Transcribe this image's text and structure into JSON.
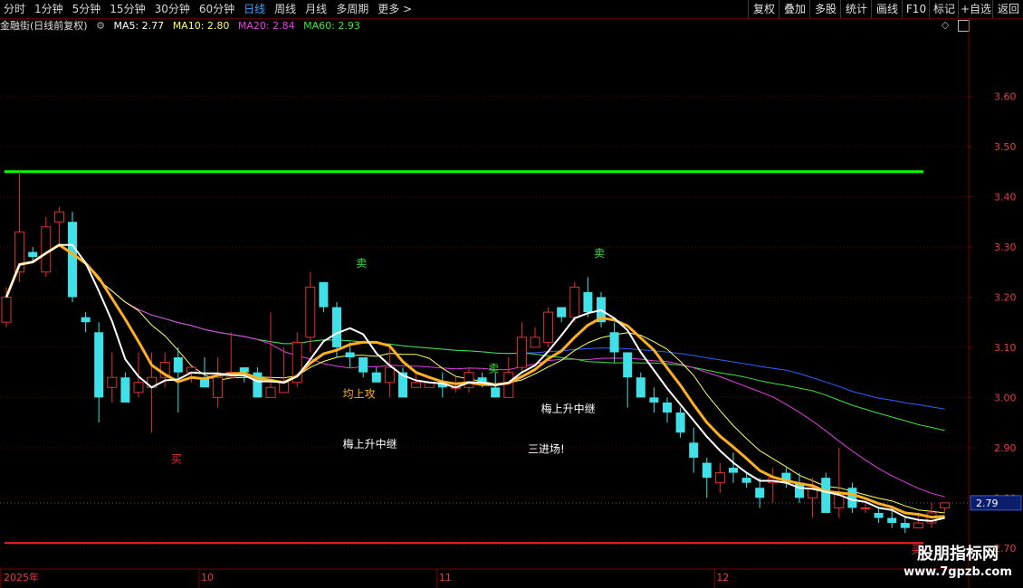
{
  "toolbar": {
    "left_items": [
      "分时",
      "1分钟",
      "5分钟",
      "15分钟",
      "30分钟",
      "60分钟",
      "日线",
      "周线",
      "月线",
      "多周期",
      "更多 >"
    ],
    "active": "日线",
    "right_items": [
      "复权",
      "叠加",
      "多股",
      "统计",
      "画线",
      "F10",
      "标记",
      "+自选",
      "返回"
    ]
  },
  "info": {
    "title": "金融街(日线前复权)",
    "ma5_label": "MA5: 2.77",
    "ma10_label": "MA10: 2.80",
    "ma20_label": "MA20: 2.84",
    "ma60_label": "MA60: 2.93"
  },
  "colors": {
    "up": "#e03030",
    "down": "#40e0e8",
    "ma5": "#ffffff",
    "ma10": "#ffff60",
    "ma20": "#e040e0",
    "ma60": "#40e040",
    "ma_long": "#3060ff",
    "thick": "#ffb020",
    "resistance": "#00ff00",
    "support": "#ff2020"
  },
  "watermark": {
    "line1": "股朋指标网",
    "line2": "www.7gpzb.com"
  },
  "chart_data": {
    "type": "candlestick",
    "ylim": [
      2.66,
      3.72
    ],
    "yticks": [
      "3.60",
      "3.50",
      "3.40",
      "3.30",
      "3.20",
      "3.10",
      "3.00",
      "2.90",
      "2.80",
      "2.70"
    ],
    "current_price": "2.79",
    "x_labels": [
      "2025年",
      "10",
      "11",
      "12"
    ],
    "resistance": 3.45,
    "support": 2.71,
    "candles": [
      [
        3.15,
        3.2,
        3.22,
        3.14
      ],
      [
        3.25,
        3.33,
        3.45,
        3.23
      ],
      [
        3.29,
        3.28,
        3.3,
        3.27
      ],
      [
        3.25,
        3.34,
        3.36,
        3.24
      ],
      [
        3.35,
        3.37,
        3.38,
        3.3
      ],
      [
        3.35,
        3.2,
        3.37,
        3.19
      ],
      [
        3.16,
        3.15,
        3.17,
        3.13
      ],
      [
        3.13,
        3.0,
        3.15,
        2.95
      ],
      [
        3.02,
        3.04,
        3.09,
        2.99
      ],
      [
        3.04,
        2.99,
        3.05,
        2.99
      ],
      [
        3.01,
        3.03,
        3.09,
        3.0
      ],
      [
        3.02,
        3.04,
        3.09,
        2.93
      ],
      [
        3.04,
        3.07,
        3.09,
        3.02
      ],
      [
        3.08,
        3.05,
        3.1,
        2.97
      ],
      [
        3.05,
        3.06,
        3.06,
        3.03
      ],
      [
        3.04,
        3.02,
        3.08,
        3.02
      ],
      [
        3.0,
        3.04,
        3.08,
        2.98
      ],
      [
        3.04,
        3.05,
        3.13,
        3.04
      ],
      [
        3.06,
        3.05,
        3.06,
        3.03
      ],
      [
        3.05,
        3.0,
        3.06,
        3.0
      ],
      [
        3.0,
        3.02,
        3.17,
        3.0
      ],
      [
        3.01,
        3.03,
        3.1,
        3.02
      ],
      [
        3.03,
        3.11,
        3.13,
        3.02
      ],
      [
        3.12,
        3.22,
        3.25,
        3.09
      ],
      [
        3.23,
        3.18,
        3.23,
        3.17
      ],
      [
        3.18,
        3.1,
        3.19,
        3.08
      ],
      [
        3.09,
        3.08,
        3.11,
        3.06
      ],
      [
        3.08,
        3.05,
        3.07,
        3.04
      ],
      [
        3.05,
        3.03,
        3.06,
        3.03
      ],
      [
        3.03,
        3.06,
        3.1,
        3.0
      ],
      [
        3.05,
        3.0,
        3.06,
        3.0
      ],
      [
        3.02,
        3.03,
        3.05,
        3.02
      ],
      [
        3.02,
        3.03,
        3.03,
        3.02
      ],
      [
        3.03,
        3.02,
        3.05,
        3.0
      ],
      [
        3.02,
        3.02,
        3.04,
        3.01
      ],
      [
        3.02,
        3.05,
        3.06,
        3.01
      ],
      [
        3.04,
        3.03,
        3.05,
        3.02
      ],
      [
        3.02,
        3.0,
        3.05,
        3.0
      ],
      [
        3.0,
        3.05,
        3.08,
        3.0
      ],
      [
        3.06,
        3.12,
        3.15,
        3.05
      ],
      [
        3.1,
        3.12,
        3.14,
        3.1
      ],
      [
        3.11,
        3.17,
        3.18,
        3.1
      ],
      [
        3.18,
        3.16,
        3.17,
        3.15
      ],
      [
        3.16,
        3.22,
        3.23,
        3.15
      ],
      [
        3.21,
        3.17,
        3.24,
        3.16
      ],
      [
        3.2,
        3.15,
        3.21,
        3.14
      ],
      [
        3.13,
        3.09,
        3.15,
        3.07
      ],
      [
        3.09,
        3.04,
        3.07,
        2.98
      ],
      [
        3.04,
        3.0,
        3.05,
        3.0
      ],
      [
        3.0,
        2.99,
        3.02,
        2.97
      ],
      [
        2.99,
        2.97,
        3.0,
        2.95
      ],
      [
        2.97,
        2.93,
        2.98,
        2.92
      ],
      [
        2.91,
        2.88,
        2.94,
        2.85
      ],
      [
        2.87,
        2.84,
        2.88,
        2.8
      ],
      [
        2.83,
        2.85,
        2.87,
        2.81
      ],
      [
        2.86,
        2.85,
        2.89,
        2.83
      ],
      [
        2.84,
        2.83,
        2.85,
        2.82
      ],
      [
        2.82,
        2.8,
        2.84,
        2.78
      ],
      [
        2.83,
        2.84,
        2.86,
        2.79
      ],
      [
        2.85,
        2.83,
        2.86,
        2.82
      ],
      [
        2.83,
        2.8,
        2.85,
        2.79
      ],
      [
        2.8,
        2.82,
        2.84,
        2.76
      ],
      [
        2.84,
        2.77,
        2.85,
        2.77
      ],
      [
        2.78,
        2.81,
        2.9,
        2.76
      ],
      [
        2.82,
        2.78,
        2.83,
        2.77
      ],
      [
        2.78,
        2.78,
        2.79,
        2.77
      ],
      [
        2.77,
        2.76,
        2.78,
        2.75
      ],
      [
        2.76,
        2.75,
        2.78,
        2.74
      ],
      [
        2.75,
        2.74,
        2.76,
        2.73
      ],
      [
        2.74,
        2.75,
        2.77,
        2.74
      ],
      [
        2.75,
        2.77,
        2.79,
        2.74
      ],
      [
        2.78,
        2.79,
        2.79,
        2.77
      ]
    ],
    "annotations": [
      {
        "text": "买",
        "date_index": 13,
        "price": 2.87,
        "color": "#e03030"
      },
      {
        "text": "卖",
        "date_index": 27,
        "price": 3.26,
        "color": "#40e040"
      },
      {
        "text": "均上攻",
        "date_index": 26,
        "price": 3.0,
        "color": "#ffb020"
      },
      {
        "text": "梅上升中继",
        "date_index": 26,
        "price": 2.9,
        "color": "#ffffff"
      },
      {
        "text": "卖",
        "date_index": 37,
        "price": 3.05,
        "color": "#40e040"
      },
      {
        "text": "梅上升中继",
        "date_index": 41,
        "price": 2.97,
        "color": "#ffffff"
      },
      {
        "text": "三进场!",
        "date_index": 40,
        "price": 2.89,
        "color": "#ffffff"
      },
      {
        "text": "卖",
        "date_index": 45,
        "price": 3.28,
        "color": "#40e040"
      },
      {
        "text": "买",
        "date_index": 69,
        "price": 2.69,
        "color": "#e03030"
      }
    ]
  }
}
